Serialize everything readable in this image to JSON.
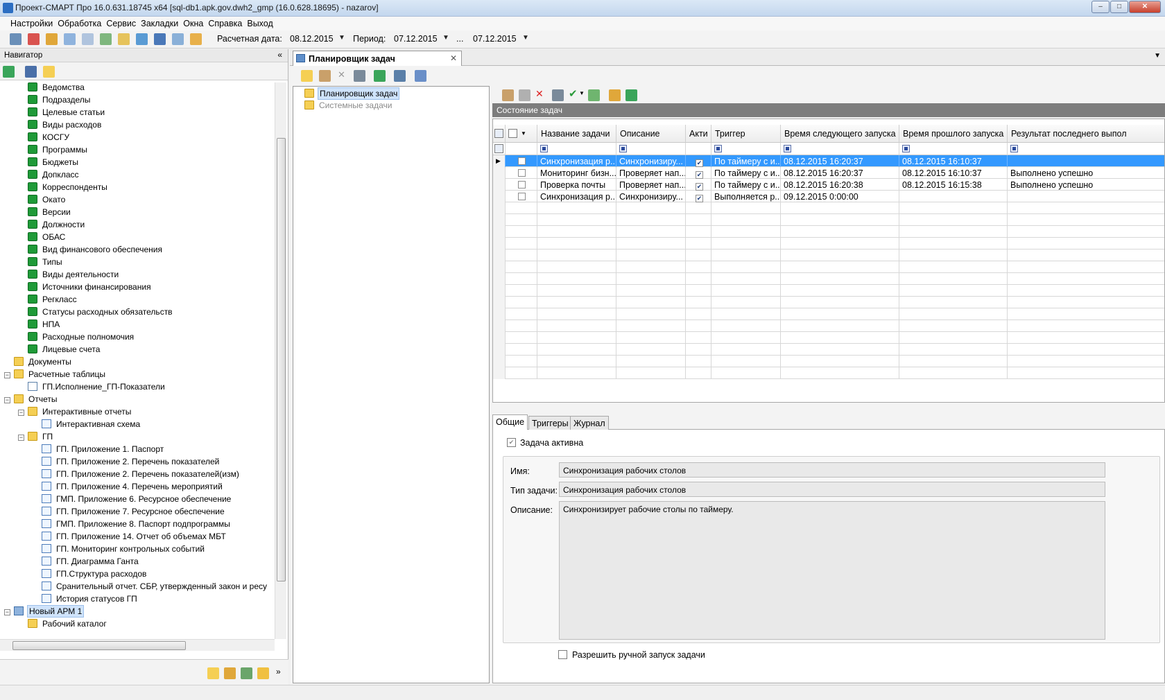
{
  "window": {
    "title": "Проект-СМАРТ Про 16.0.631.18745 x64 [sql-db1.apk.gov.dwh2_gmp (16.0.628.18695) - nazarov]"
  },
  "menu": [
    "Настройки",
    "Обработка",
    "Сервис",
    "Закладки",
    "Окна",
    "Справка",
    "Выход"
  ],
  "toolbar": {
    "calc_date_label": "Расчетная дата:",
    "calc_date": "08.12.2015",
    "period_label": "Период:",
    "period_from": "07.12.2015",
    "period_sep": "...",
    "period_to": "07.12.2015"
  },
  "navigator": {
    "title": "Навигатор",
    "items": [
      "Ведомства",
      "Подразделы",
      "Целевые статьи",
      "Виды расходов",
      "КОСГУ",
      "Программы",
      "Бюджеты",
      "Допкласс",
      "Корреспонденты",
      "Окато",
      "Версии",
      "Должности",
      "ОБАС",
      "Вид финансового обеспечения",
      "Типы",
      "Виды деятельности",
      "Источники финансирования",
      "Регкласс",
      "Статусы расходных обязательств",
      "НПА",
      "Расходные полномочия",
      "Лицевые счета"
    ],
    "documents": "Документы",
    "calc_tables": "Расчетные таблицы",
    "calc_table_item": "ГП.Исполнение_ГП-Показатели",
    "reports": "Отчеты",
    "interactive_reports": "Интерактивные отчеты",
    "interactive_scheme": "Интерактивная схема",
    "gp": "ГП",
    "gp_items": [
      "ГП. Приложение 1. Паспорт",
      "ГП. Приложение 2. Перечень показателей",
      "ГП. Приложение 2. Перечень показателей(изм)",
      "ГП. Приложение 4. Перечень мероприятий",
      "ГМП. Приложение 6. Ресурсное обеспечение",
      "ГП. Приложение 7. Ресурсное обеспечение",
      "ГМП. Приложение 8. Паспорт подпрограммы",
      "ГП. Приложение 14. Отчет об объемах МБТ",
      "ГП. Мониторинг контрольных событий",
      "ГП. Диаграмма Ганта",
      "ГП.Структура расходов",
      "Сранительный отчет. СБР, утвержденный закон и ресу",
      "История статусов ГП"
    ],
    "new_arm": "Новый АРМ 1",
    "work_catalog": "Рабочий каталог"
  },
  "document": {
    "tab_title": "Планировщик задач",
    "tree": [
      "Планировщик задач",
      "Системные задачи"
    ],
    "state_header": "Состояние задач",
    "columns": [
      "Название задачи",
      "Описание",
      "Акти",
      "Триггер",
      "Время следующего запуска",
      "Время прошлого запуска",
      "Результат последнего выпол"
    ],
    "rows": [
      {
        "name": "Синхронизация р...",
        "desc": "Синхронизиру...",
        "active": true,
        "trigger": "По таймеру с и...",
        "next": "08.12.2015 16:20:37",
        "prev": "08.12.2015 16:10:37",
        "result": ""
      },
      {
        "name": "Мониторинг бизн...",
        "desc": "Проверяет нап...",
        "active": true,
        "trigger": "По таймеру с и...",
        "next": "08.12.2015 16:20:37",
        "prev": "08.12.2015 16:10:37",
        "result": "Выполнено успешно"
      },
      {
        "name": "Проверка почты",
        "desc": "Проверяет нап...",
        "active": true,
        "trigger": "По таймеру с и...",
        "next": "08.12.2015 16:20:38",
        "prev": "08.12.2015 16:15:38",
        "result": "Выполнено успешно"
      },
      {
        "name": "Синхронизация р...",
        "desc": "Синхронизиру...",
        "active": true,
        "trigger": "Выполняется р...",
        "next": "09.12.2015 0:00:00",
        "prev": "",
        "result": ""
      }
    ],
    "detail_tabs": [
      "Общие",
      "Триггеры",
      "Журнал"
    ],
    "task_active_label": "Задача активна",
    "name_label": "Имя:",
    "name_value": "Синхронизация рабочих столов",
    "type_label": "Тип задачи:",
    "type_value": "Синхронизация рабочих столов",
    "desc_label": "Описание:",
    "desc_value": "Синхронизирует рабочие столы по таймеру.",
    "manual_label": "Разрешить ручной запуск задачи"
  },
  "colors": {
    "selection": "#3399ff",
    "header_bar": "#7d7d7d",
    "tree_icon": "#1f9a38",
    "folder": "#f5cf54"
  }
}
